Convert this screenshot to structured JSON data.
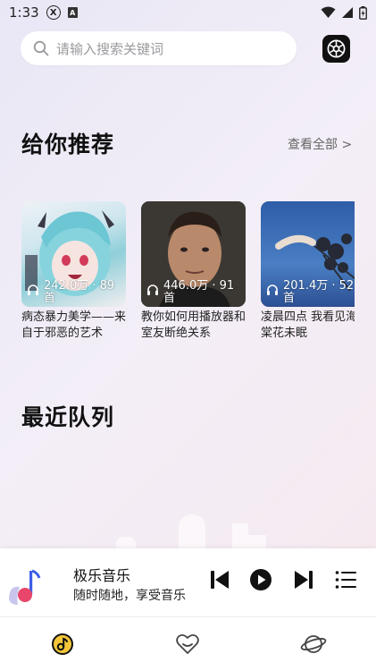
{
  "status": {
    "time": "1:33",
    "x_badge": "X",
    "a_badge": "A"
  },
  "search": {
    "placeholder": "请输入搜索关键词"
  },
  "recommend": {
    "title": "给你推荐",
    "see_all": "查看全部 >"
  },
  "cards": [
    {
      "stat": "242.0万 · 89首",
      "title": "病态暴力美学——来自于邪恶的艺术"
    },
    {
      "stat": "446.0万 · 91首",
      "title": "教你如何用播放器和室友断绝关系"
    },
    {
      "stat": "201.4万 · 52首",
      "title": "凌晨四点 我看见海棠花未眠"
    }
  ],
  "queue": {
    "title": "最近队列"
  },
  "player": {
    "title": "极乐音乐",
    "subtitle": "随时随地，享受音乐"
  },
  "colors": {
    "accent": "#111111",
    "logo_blue": "#3d5de8",
    "logo_red": "#e8466a"
  },
  "icons": {
    "settings": "settings-icon",
    "prev": "skip-previous-icon",
    "play": "play-icon",
    "next": "skip-next-icon",
    "playlist": "playlist-icon",
    "tab_music": "music-disc-icon",
    "tab_favorite": "heart-icon",
    "tab_discover": "planet-icon"
  }
}
